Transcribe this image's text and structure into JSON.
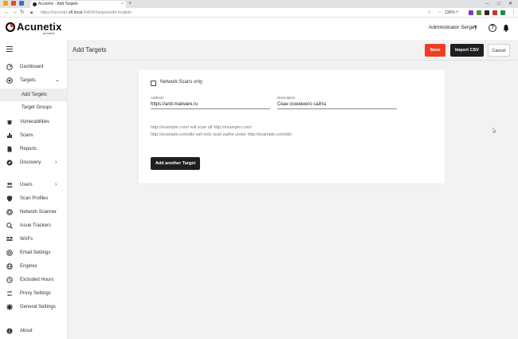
{
  "browser": {
    "tab_title": "Acunetix - Add Targets",
    "tab_close": "×",
    "new_tab": "+",
    "url_prefix": "https://acunetix.",
    "url_host": "sft.local",
    "url_path": ":3443/#/targets/add-multiple",
    "zoom": "130%"
  },
  "header": {
    "logo_text": "Acunetix",
    "logo_sub": "by Invicti",
    "user_name": "Administrator Sergey",
    "help_glyph": "?"
  },
  "sidebar": {
    "items": [
      {
        "label": "Dashboard",
        "icon": "dashboard-icon"
      },
      {
        "label": "Targets",
        "icon": "targets-icon",
        "chevron": "⌄"
      },
      {
        "label": "Add Targets",
        "sub": true,
        "active": true
      },
      {
        "label": "Target Groups",
        "sub": true
      },
      {
        "label": "Vulnerabilities",
        "icon": "bug-icon"
      },
      {
        "label": "Scans",
        "icon": "scans-icon"
      },
      {
        "label": "Reports",
        "icon": "reports-icon"
      },
      {
        "label": "Discovery",
        "icon": "discovery-icon",
        "chevron": "›"
      },
      {
        "label": "Users",
        "icon": "users-icon",
        "chevron": "›"
      },
      {
        "label": "Scan Profiles",
        "icon": "shield-icon"
      },
      {
        "label": "Network Scanner",
        "icon": "network-icon"
      },
      {
        "label": "Issue Trackers",
        "icon": "issue-tracker-icon"
      },
      {
        "label": "WAFs",
        "icon": "waf-icon"
      },
      {
        "label": "Email Settings",
        "icon": "email-icon"
      },
      {
        "label": "Engines",
        "icon": "globe-icon"
      },
      {
        "label": "Excluded Hours",
        "icon": "clock-icon"
      },
      {
        "label": "Proxy Settings",
        "icon": "proxy-icon"
      },
      {
        "label": "General Settings",
        "icon": "gear-icon"
      },
      {
        "label": "About",
        "icon": "info-icon"
      }
    ]
  },
  "page": {
    "title": "Add Targets",
    "save_label": "Save",
    "import_label": "Import CSV",
    "cancel_label": "Cancel"
  },
  "form": {
    "network_scans_label": "Network Scans only",
    "network_scans_checked": false,
    "address_label": "Address",
    "address_value": "https://anti-malware.ru",
    "description_label": "Description",
    "description_value": "Скан основного сайта",
    "hint_line1": "http://example.com/ will scan all http://example.com/",
    "hint_line2": "http://example.com/dir/ will only scan paths under http://example.com/dir/",
    "add_another_label": "Add another Target"
  },
  "colors": {
    "accent_red": "#ee3e23",
    "dark_button": "#1f1f1f",
    "content_bg": "#f2f2f2"
  }
}
